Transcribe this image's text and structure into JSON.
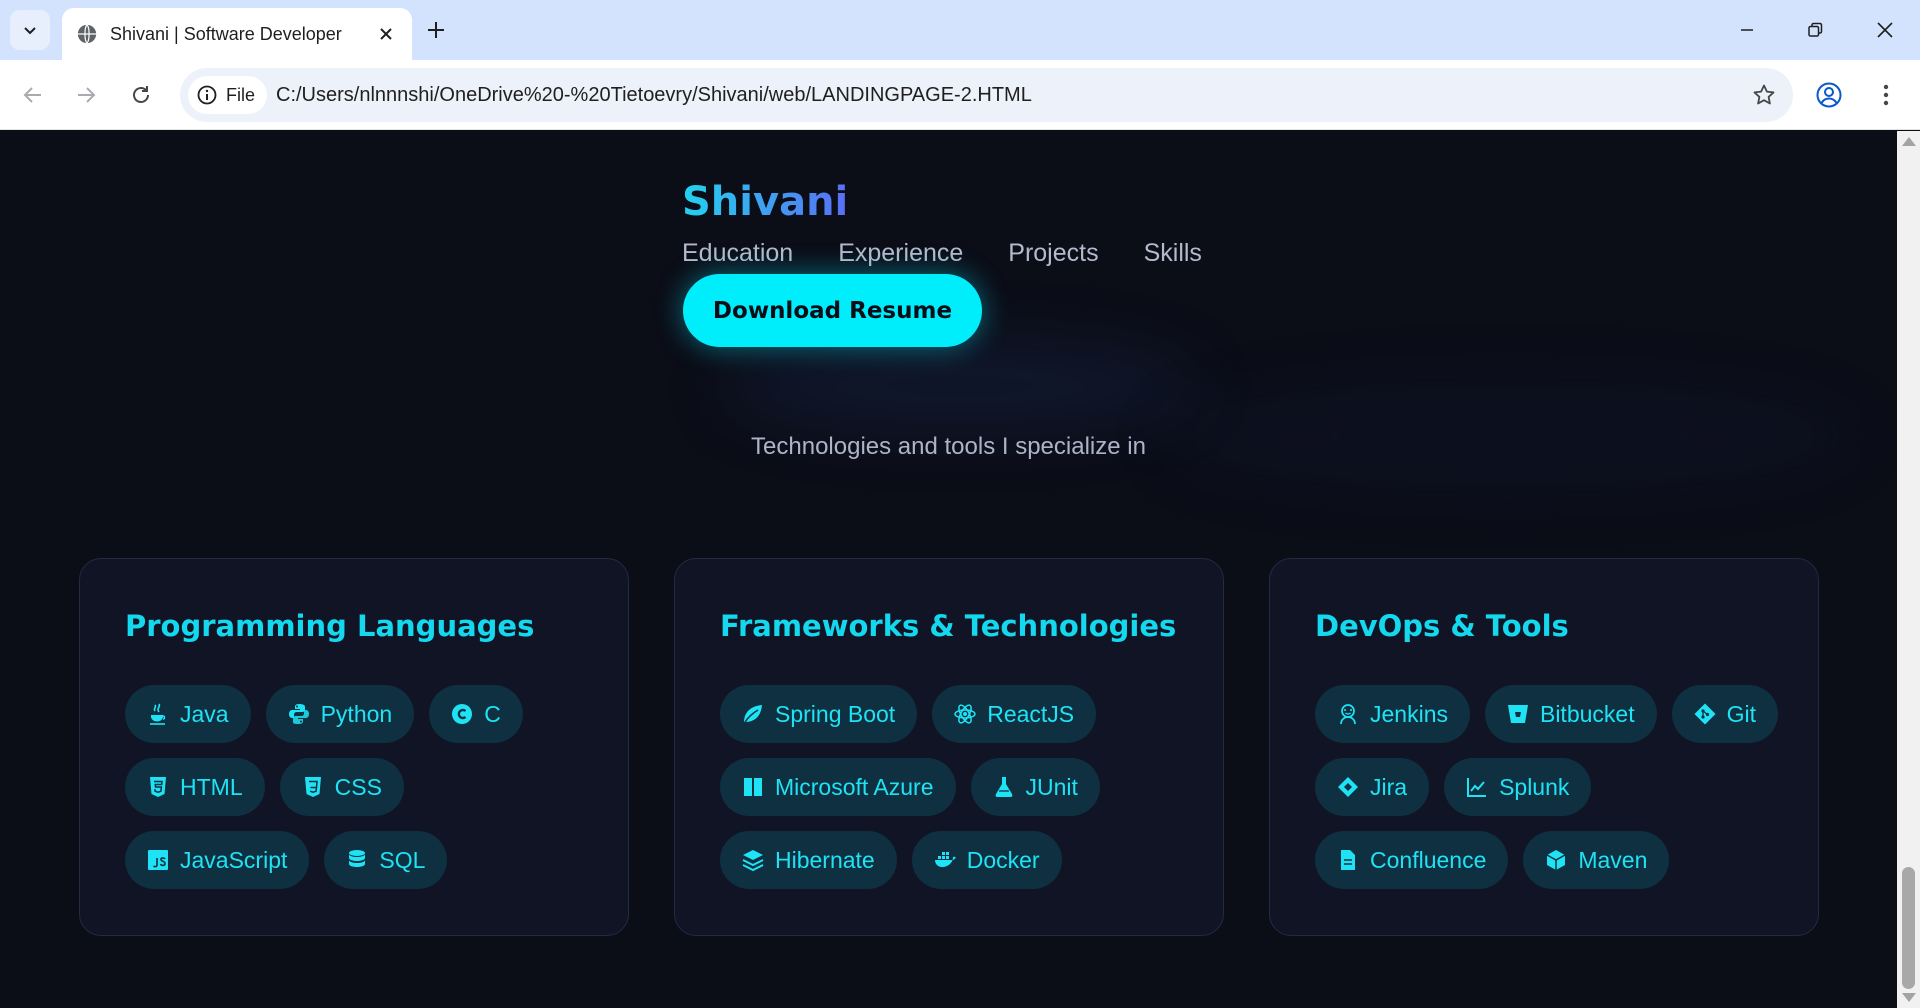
{
  "browser": {
    "tab_title": "Shivani | Software Developer",
    "url_chip": "File",
    "url": "C:/Users/nlnnnshi/OneDrive%20-%20Tietoevry/Shivani/web/LANDINGPAGE-2.HTML"
  },
  "page": {
    "brand": "Shivani",
    "nav": [
      "Education",
      "Experience",
      "Projects",
      "Skills"
    ],
    "resume_button": "Download Resume",
    "subtitle": "Technologies and tools I specialize in",
    "cards": [
      {
        "title": "Programming Languages",
        "items": [
          {
            "label": "Java",
            "icon": "java-icon"
          },
          {
            "label": "Python",
            "icon": "python-icon"
          },
          {
            "label": "C",
            "icon": "c-icon"
          },
          {
            "label": "HTML",
            "icon": "html5-icon"
          },
          {
            "label": "CSS",
            "icon": "css3-icon"
          },
          {
            "label": "JavaScript",
            "icon": "javascript-icon"
          },
          {
            "label": "SQL",
            "icon": "database-icon"
          }
        ]
      },
      {
        "title": "Frameworks & Technologies",
        "items": [
          {
            "label": "Spring Boot",
            "icon": "leaf-icon"
          },
          {
            "label": "ReactJS",
            "icon": "react-icon"
          },
          {
            "label": "Microsoft Azure",
            "icon": "microsoft-icon"
          },
          {
            "label": "JUnit",
            "icon": "flask-icon"
          },
          {
            "label": "Hibernate",
            "icon": "layers-icon"
          },
          {
            "label": "Docker",
            "icon": "docker-icon"
          }
        ]
      },
      {
        "title": "DevOps & Tools",
        "items": [
          {
            "label": "Jenkins",
            "icon": "jenkins-icon"
          },
          {
            "label": "Bitbucket",
            "icon": "bitbucket-icon"
          },
          {
            "label": "Git",
            "icon": "git-icon"
          },
          {
            "label": "Jira",
            "icon": "jira-icon"
          },
          {
            "label": "Splunk",
            "icon": "chart-line-icon"
          },
          {
            "label": "Confluence",
            "icon": "file-icon"
          },
          {
            "label": "Maven",
            "icon": "cube-icon"
          }
        ]
      }
    ]
  },
  "colors": {
    "accent": "#00eefc",
    "background": "#0b0d17",
    "card": "#111425",
    "pill": "#0e3040"
  }
}
